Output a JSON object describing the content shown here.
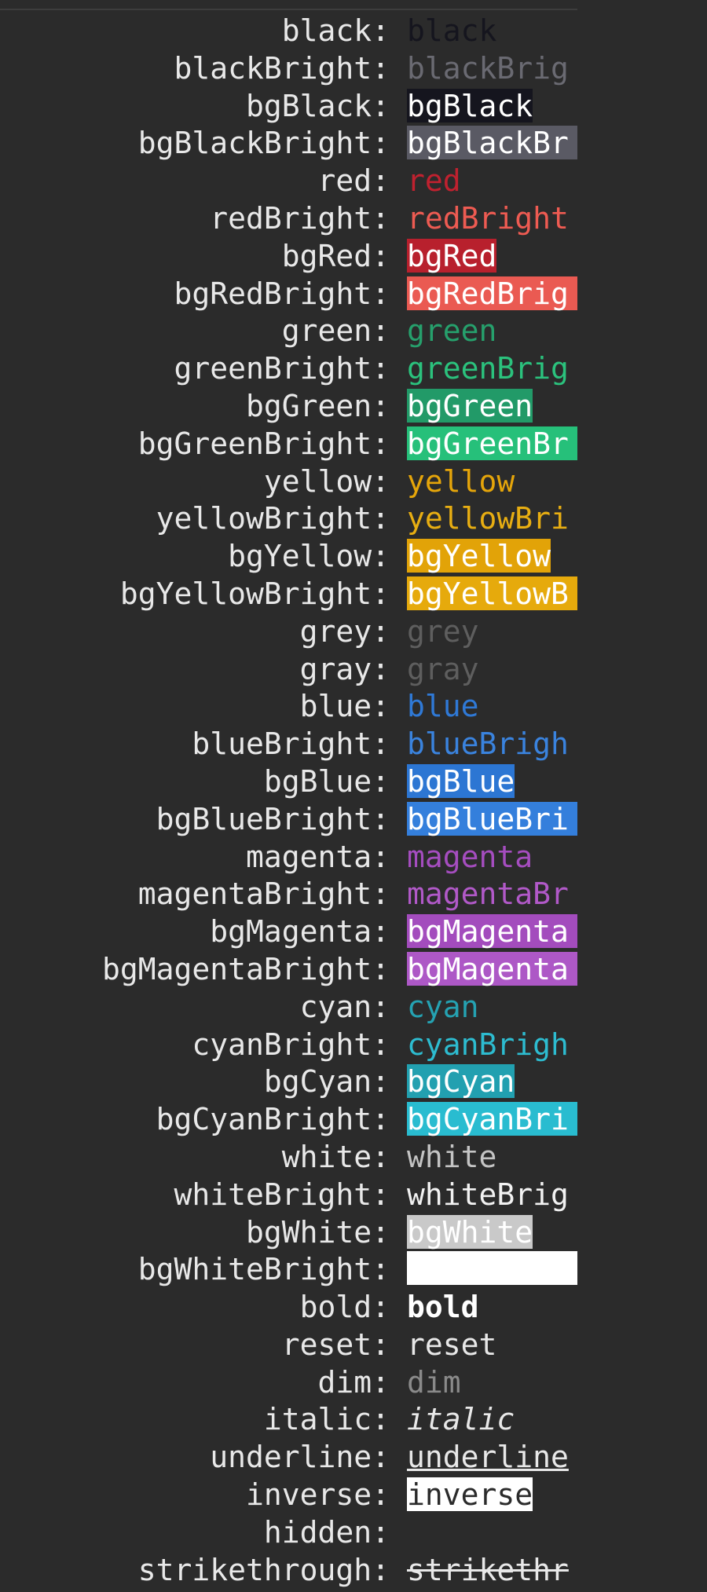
{
  "rows": [
    {
      "label": "black:",
      "sample": "black",
      "fg": "#15151e",
      "bg": null
    },
    {
      "label": "blackBright:",
      "sample": "blackBrig",
      "fg": "#6a6a72",
      "bg": null
    },
    {
      "label": "bgBlack:",
      "sample": "bgBlack",
      "fg": "#ffffff",
      "bg": "#15151e",
      "fill": false
    },
    {
      "label": "bgBlackBright:",
      "sample": "bgBlackBr",
      "fg": "#ffffff",
      "bg": "#5a5a64",
      "fill": true
    },
    {
      "label": "red:",
      "sample": "red",
      "fg": "#c0212f",
      "bg": null
    },
    {
      "label": "redBright:",
      "sample": "redBright",
      "fg": "#ee5b52",
      "bg": null
    },
    {
      "label": "bgRed:",
      "sample": "bgRed",
      "fg": "#ffffff",
      "bg": "#b8202d",
      "fill": false
    },
    {
      "label": "bgRedBright:",
      "sample": "bgRedBrig",
      "fg": "#ffffff",
      "bg": "#ea5a52",
      "fill": true
    },
    {
      "label": "green:",
      "sample": "green",
      "fg": "#26a06c",
      "bg": null
    },
    {
      "label": "greenBright:",
      "sample": "greenBrig",
      "fg": "#2bc27d",
      "bg": null
    },
    {
      "label": "bgGreen:",
      "sample": "bgGreen",
      "fg": "#ffffff",
      "bg": "#229a68",
      "fill": false
    },
    {
      "label": "bgGreenBright:",
      "sample": "bgGreenBr",
      "fg": "#ffffff",
      "bg": "#26c07a",
      "fill": true
    },
    {
      "label": "yellow:",
      "sample": "yellow",
      "fg": "#e5a50a",
      "bg": null
    },
    {
      "label": "yellowBright:",
      "sample": "yellowBri",
      "fg": "#e8ae12",
      "bg": null
    },
    {
      "label": "bgYellow:",
      "sample": "bgYellow",
      "fg": "#ffffff",
      "bg": "#e2a308",
      "fill": false
    },
    {
      "label": "bgYellowBright:",
      "sample": "bgYellowB",
      "fg": "#ffffff",
      "bg": "#e6aa0c",
      "fill": true
    },
    {
      "label": "grey:",
      "sample": "grey",
      "fg": "#5e5e5e",
      "bg": null
    },
    {
      "label": "gray:",
      "sample": "gray",
      "fg": "#5e5e5e",
      "bg": null
    },
    {
      "label": "blue:",
      "sample": "blue",
      "fg": "#2f79d6",
      "bg": null
    },
    {
      "label": "blueBright:",
      "sample": "blueBrigh",
      "fg": "#3a83de",
      "bg": null
    },
    {
      "label": "bgBlue:",
      "sample": "bgBlue",
      "fg": "#ffffff",
      "bg": "#2c76d3",
      "fill": false
    },
    {
      "label": "bgBlueBright:",
      "sample": "bgBlueBri",
      "fg": "#ffffff",
      "bg": "#347fdc",
      "fill": true
    },
    {
      "label": "magenta:",
      "sample": "magenta",
      "fg": "#a54dbf",
      "bg": null
    },
    {
      "label": "magentaBright:",
      "sample": "magentaBr",
      "fg": "#b159c8",
      "bg": null
    },
    {
      "label": "bgMagenta:",
      "sample": "bgMagenta",
      "fg": "#ffffff",
      "bg": "#a34cbd",
      "fill": true
    },
    {
      "label": "bgMagentaBright:",
      "sample": "bgMagenta",
      "fg": "#ffffff",
      "bg": "#ad58c6",
      "fill": true
    },
    {
      "label": "cyan:",
      "sample": "cyan",
      "fg": "#25a2b2",
      "bg": null
    },
    {
      "label": "cyanBright:",
      "sample": "cyanBrigh",
      "fg": "#2dbcd0",
      "bg": null
    },
    {
      "label": "bgCyan:",
      "sample": "bgCyan",
      "fg": "#ffffff",
      "bg": "#22a0b0",
      "fill": false
    },
    {
      "label": "bgCyanBright:",
      "sample": "bgCyanBri",
      "fg": "#ffffff",
      "bg": "#29bcd0",
      "fill": true
    },
    {
      "label": "white:",
      "sample": "white",
      "fg": "#c4c4c4",
      "bg": null
    },
    {
      "label": "whiteBright:",
      "sample": "whiteBrig",
      "fg": "#f2f2f2",
      "bg": null
    },
    {
      "label": "bgWhite:",
      "sample": "bgWhite",
      "fg": "#ffffff",
      "bg": "#c9c9c9",
      "fill": false
    },
    {
      "label": "bgWhiteBright:",
      "sample": "",
      "fg": "#ffffff",
      "bg": "#ffffff",
      "fill": true
    },
    {
      "label": "bold:",
      "sample": "bold",
      "fg": "#ffffff",
      "bg": null,
      "style": "bold"
    },
    {
      "label": "reset:",
      "sample": "reset",
      "fg": "#e8e8e8",
      "bg": null
    },
    {
      "label": "dim:",
      "sample": "dim",
      "fg": "#8a8a8a",
      "bg": null
    },
    {
      "label": "italic:",
      "sample": "italic",
      "fg": "#e8e8e8",
      "bg": null,
      "style": "italic"
    },
    {
      "label": "underline:",
      "sample": "underline",
      "fg": "#e8e8e8",
      "bg": null,
      "style": "underline"
    },
    {
      "label": "inverse:",
      "sample": "inverse",
      "fg": "#2b2b2b",
      "bg": "#ffffff",
      "fill": false
    },
    {
      "label": "hidden:",
      "sample": "",
      "fg": "#2b2b2b",
      "bg": null
    },
    {
      "label": "strikethrough:",
      "sample": "strikethr",
      "fg": "#e8e8e8",
      "bg": null,
      "style": "strike"
    }
  ]
}
